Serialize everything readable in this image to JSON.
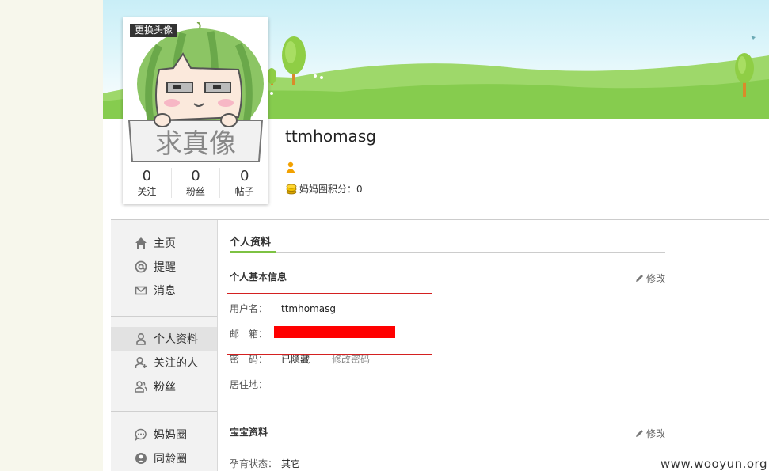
{
  "avatar": {
    "change_label": "更换头像",
    "sign_text": "求真像"
  },
  "stats": [
    {
      "num": "0",
      "label": "关注"
    },
    {
      "num": "0",
      "label": "粉丝"
    },
    {
      "num": "0",
      "label": "帖子"
    }
  ],
  "user": {
    "name": "ttmhomasg",
    "points_label": "妈妈圈积分：",
    "points_value": "0"
  },
  "sidebar": {
    "group1": [
      {
        "label": "主页",
        "icon": "home-icon"
      },
      {
        "label": "提醒",
        "icon": "at-icon"
      },
      {
        "label": "消息",
        "icon": "mail-icon"
      }
    ],
    "group2": [
      {
        "label": "个人资料",
        "icon": "person-icon"
      },
      {
        "label": "关注的人",
        "icon": "person-add-icon"
      },
      {
        "label": "粉丝",
        "icon": "people-icon"
      }
    ],
    "group3": [
      {
        "label": "妈妈圈",
        "icon": "chat-icon"
      },
      {
        "label": "同龄圈",
        "icon": "circle-person-icon"
      }
    ]
  },
  "content": {
    "tab": "个人资料",
    "basic_title": "个人基本信息",
    "edit_label": "修改",
    "fields": {
      "username_key": "用户名：",
      "username_val": "ttmhomasg",
      "email_key": "邮　箱：",
      "password_key": "密　码：",
      "password_val": "已隐藏",
      "change_password": "修改密码",
      "residence_key": "居住地："
    },
    "baby_title": "宝宝资料",
    "pregnancy_key": "孕育状态：",
    "pregnancy_val": "其它"
  },
  "watermark": "www.wooyun.org",
  "colors": {
    "accent_green": "#7dc243",
    "highlight_red": "#ff0000"
  }
}
